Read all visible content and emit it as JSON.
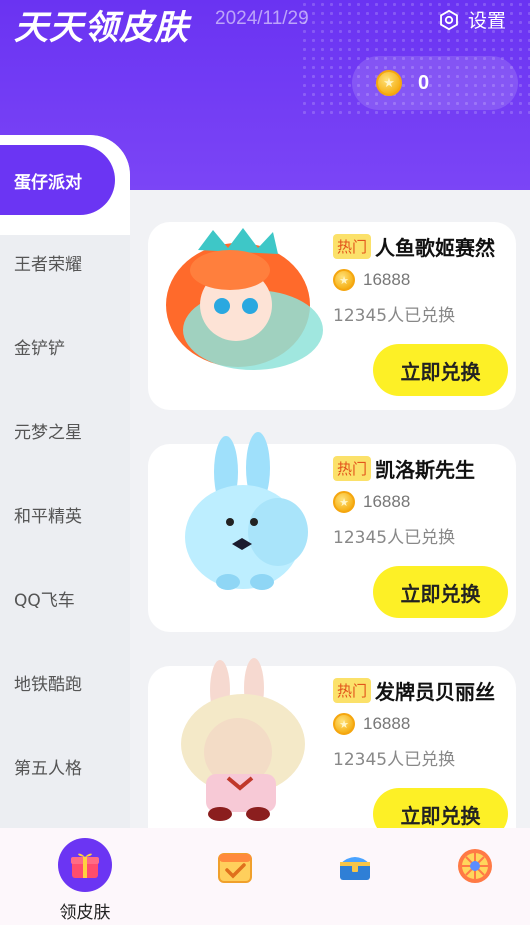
{
  "header": {
    "title": "天天领皮肤",
    "date": "2024/11/29",
    "settings_label": "设置",
    "coin_balance": "0"
  },
  "sidebar": {
    "items": [
      {
        "label": "蛋仔派对",
        "active": true
      },
      {
        "label": "王者荣耀",
        "active": false
      },
      {
        "label": "金铲铲",
        "active": false
      },
      {
        "label": "元梦之星",
        "active": false
      },
      {
        "label": "和平精英",
        "active": false
      },
      {
        "label": "QQ飞车",
        "active": false
      },
      {
        "label": "地铁酷跑",
        "active": false
      },
      {
        "label": "第五人格",
        "active": false
      }
    ]
  },
  "items": [
    {
      "badge": "热门",
      "name": "人鱼歌姬赛然",
      "price": "16888",
      "redeemed": "12345人已兑换",
      "button": "立即兑换",
      "image": "mermaid-character-icon"
    },
    {
      "badge": "热门",
      "name": "凯洛斯先生",
      "price": "16888",
      "redeemed": "12345人已兑换",
      "button": "立即兑换",
      "image": "blue-bunny-character-icon"
    },
    {
      "badge": "热门",
      "name": "发牌员贝丽丝",
      "price": "16888",
      "redeemed": "12345人已兑换",
      "button": "立即兑换",
      "image": "bunny-dealer-character-icon"
    }
  ],
  "bottom_nav": {
    "items": [
      {
        "label": "领皮肤",
        "icon": "gift-icon",
        "active": true
      },
      {
        "label": "",
        "icon": "calendar-check-icon",
        "active": false
      },
      {
        "label": "",
        "icon": "treasure-chest-icon",
        "active": false
      },
      {
        "label": "",
        "icon": "lucky-wheel-icon",
        "active": false
      }
    ]
  },
  "colors": {
    "primary": "#6b35f3",
    "button": "#fdf026",
    "hot_badge_bg": "#fbe16a",
    "hot_badge_text": "#e2541b",
    "coin": "#f6b21a"
  }
}
